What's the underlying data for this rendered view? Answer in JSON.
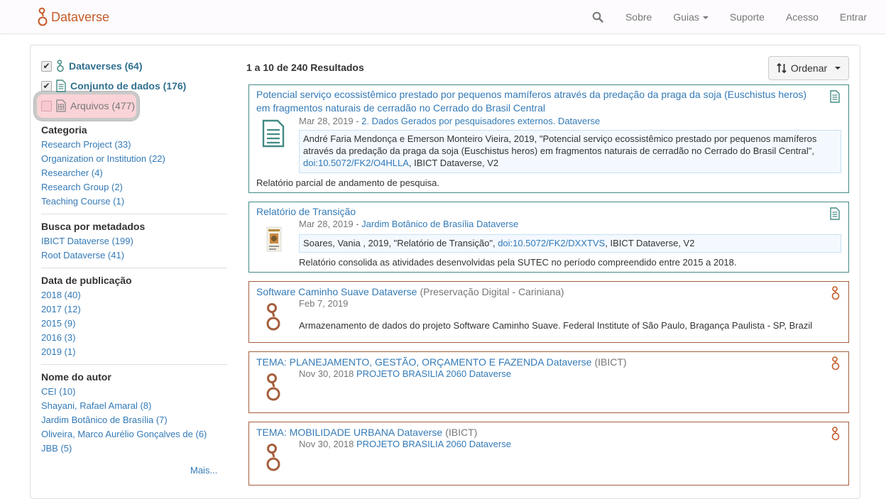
{
  "navbar": {
    "brand": "Dataverse",
    "items": [
      "Sobre",
      "Guias",
      "Suporte",
      "Acesso",
      "Entrar"
    ]
  },
  "sidebar": {
    "types": [
      {
        "label": "Dataverses (64)",
        "checked": true
      },
      {
        "label": "Conjunto de dados (176)",
        "checked": true
      },
      {
        "label": "Arquivos (477)",
        "checked": false
      }
    ],
    "facets": [
      {
        "title": "Categoria",
        "items": [
          "Research Project (33)",
          "Organization or Institution (22)",
          "Researcher (4)",
          "Research Group (2)",
          "Teaching Course (1)"
        ]
      },
      {
        "title": "Busca por metadados",
        "items": [
          "IBICT Dataverse (199)",
          "Root Dataverse (41)"
        ]
      },
      {
        "title": "Data de publicação",
        "items": [
          "2018 (40)",
          "2017 (12)",
          "2015 (9)",
          "2016 (3)",
          "2019 (1)"
        ]
      },
      {
        "title": "Nome do autor",
        "items": [
          "CEI (10)",
          "Shayani, Rafael Amaral (8)",
          "Jardim Botânico de Brasília (7)",
          "Oliveira, Marco Aurélio Gonçalves de (6)",
          "JBB (5)"
        ]
      }
    ],
    "more": "Mais..."
  },
  "results": {
    "count_text": "1 a 10 de 240 Resultados",
    "sort_label": "Ordenar",
    "cards": [
      {
        "title_line1": "Potencial serviço ecossistêmico prestado por pequenos mamíferos através da predação da praga da soja (Euschistus heros)",
        "title_line2": "em fragmentos naturais de cerradão no Cerrado do Brasil Central",
        "date": "Mar 28, 2019 - ",
        "parent": "2. Dados Gerados por pesquisadores externos. Dataverse",
        "citation_a": "André Faria Mendonça e Emerson Monteiro Vieira, 2019, \"Potencial serviço ecossistêmico prestado por pequenos mamíferos através da predação da praga da soja (Euschistus heros) em fragmentos naturais de cerradão no Cerrado do Brasil Central\",",
        "doi": "doi:10.5072/FK2/O4HLLA",
        "citation_b": ", IBICT Dataverse, V2",
        "description": "Relatório parcial de andamento de pesquisa."
      },
      {
        "title": "Relatório de Transição",
        "date": "Mar 28, 2019 - ",
        "parent": "Jardim Botânico de Brasília Dataverse",
        "citation_a": "Soares, Vania , 2019, \"Relatório de Transição\", ",
        "doi": "doi:10.5072/FK2/DXXTVS",
        "citation_b": ", IBICT Dataverse, V2",
        "description": "Relatório consolida as atividades desenvolvidas pela SUTEC no período compreendido entre 2015 a 2018."
      },
      {
        "title": "Software Caminho Suave Dataverse",
        "affiliation": "(Preservação Digital - Cariniana)",
        "date": "Feb 7, 2019",
        "description": "Armazenamento de dados do projeto Software Caminho Suave. Federal Institute of São Paulo, Bragança Paulista - SP, Brazil"
      },
      {
        "title": "TEMA: PLANEJAMENTO, GESTÃO, ORÇAMENTO E FAZENDA Dataverse",
        "affiliation": "(IBICT)",
        "date": "Nov 30, 2018",
        "parent": "PROJETO BRASILIA 2060 Dataverse"
      },
      {
        "title": "TEMA: MOBILIDADE URBANA Dataverse",
        "affiliation": "(IBICT)",
        "date": "Nov 30, 2018",
        "parent": "PROJETO BRASILIA 2060 Dataverse"
      }
    ]
  },
  "colors": {
    "brand": "#c55b28",
    "dataset_border": "#428b85",
    "dataverse_border": "#a55e3c",
    "link": "#337ab7"
  },
  "icons": [
    "search-icon",
    "sort-icon",
    "dataverse-icon",
    "dataset-icon",
    "file-icon"
  ]
}
